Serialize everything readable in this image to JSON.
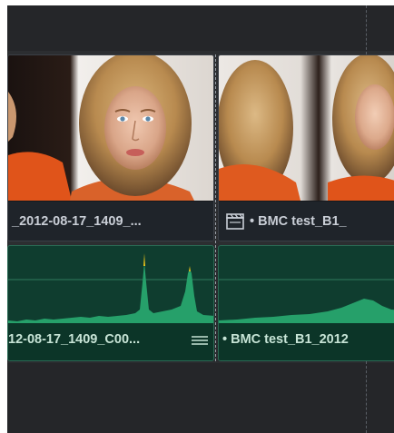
{
  "timeline": {
    "video_clips": [
      {
        "label": "_2012-08-17_1409_..."
      },
      {
        "label": "• BMC test_B1_",
        "icon": "clapperboard-icon"
      }
    ],
    "audio_clips": [
      {
        "label": "12-08-17_1409_C00...",
        "icon": "menu-lines-icon"
      },
      {
        "label": "• BMC test_B1_2012"
      }
    ]
  },
  "colors": {
    "background": "#252629",
    "clip_label_bg": "#1f242a",
    "audio_clip_bg": "#0f3d2f",
    "waveform": "#27a86f",
    "waveform_peak": "#e8c21a"
  }
}
